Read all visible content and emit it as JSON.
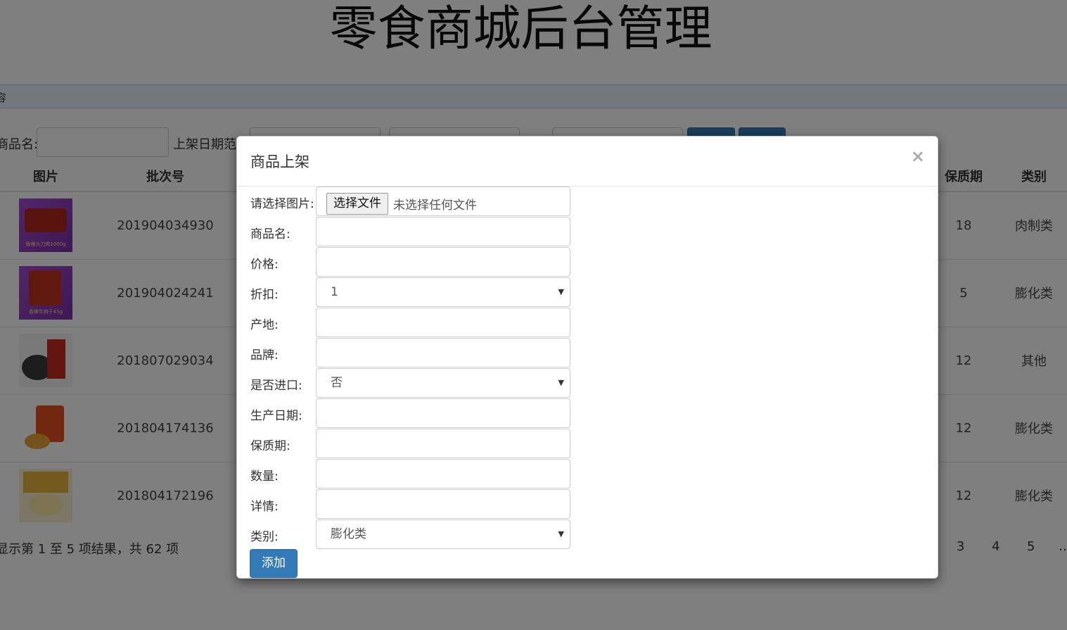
{
  "page": {
    "title": "零食商城后台管理"
  },
  "tab": {
    "label": "容"
  },
  "search": {
    "name_label": "商品名:",
    "date_label": "上架日期范"
  },
  "table": {
    "headers": {
      "image": "图片",
      "batch": "批次号",
      "shelf_life": "保质期",
      "category": "类别"
    },
    "rows": [
      {
        "batch": "201904034930",
        "shelf_life": "18",
        "category": "肉制类",
        "image_caption": "香辣大刀肉1000g"
      },
      {
        "batch": "201904024241",
        "shelf_life": "5",
        "category": "膨化类",
        "image_caption": "香辣牛肉干45g"
      },
      {
        "batch": "201807029034",
        "shelf_life": "12",
        "category": "其他",
        "image_caption": ""
      },
      {
        "batch": "201804174136",
        "shelf_life": "12",
        "category": "膨化类",
        "image_caption": ""
      },
      {
        "batch": "201804172196",
        "shelf_life": "12",
        "category": "膨化类",
        "image_caption": ""
      }
    ],
    "info": "显示第 1 至 5 项结果，共 62 项",
    "pages": [
      "3",
      "4",
      "5",
      "…"
    ]
  },
  "modal": {
    "title": "商品上架",
    "close": "×",
    "fields": {
      "image": {
        "label": "请选择图片:",
        "button": "选择文件",
        "status": "未选择任何文件"
      },
      "name": {
        "label": "商品名:",
        "value": ""
      },
      "price": {
        "label": "价格:",
        "value": ""
      },
      "discount": {
        "label": "折扣:",
        "value": "1"
      },
      "origin": {
        "label": "产地:",
        "value": ""
      },
      "brand": {
        "label": "品牌:",
        "value": ""
      },
      "imported": {
        "label": "是否进口:",
        "value": "否"
      },
      "prod_date": {
        "label": "生产日期:",
        "value": ""
      },
      "shelf_life": {
        "label": "保质期:",
        "value": ""
      },
      "quantity": {
        "label": "数量:",
        "value": ""
      },
      "detail": {
        "label": "详情:",
        "value": ""
      },
      "category": {
        "label": "类别:",
        "value": "膨化类"
      }
    },
    "submit": "添加"
  },
  "colors": {
    "primary": "#337ab7",
    "tab_bg": "#e7f0fb"
  },
  "icons": {
    "dropdown": "caret-down-icon",
    "close": "close-icon"
  }
}
